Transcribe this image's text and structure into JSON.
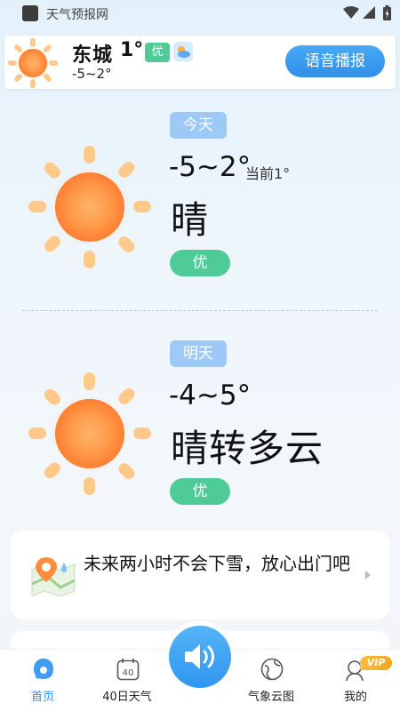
{
  "status_bar": {
    "app_name": "天气预报网"
  },
  "header": {
    "city": "东城",
    "current_temp": "1°",
    "aqi": "优",
    "temp_range": "-5~2°",
    "voice_button": "语音播报"
  },
  "today": {
    "tag": "今天",
    "temp_range": "-5~2°",
    "current": "当前1°",
    "condition": "晴",
    "aqi": "优"
  },
  "tomorrow": {
    "tag": "明天",
    "temp_range": "-4~5°",
    "condition": "晴转多云",
    "aqi": "优"
  },
  "advisory": {
    "text": "未来两小时不会下雪，放心出门吧"
  },
  "nav": {
    "items": [
      {
        "label": "首页",
        "icon": "home-icon",
        "active": true
      },
      {
        "label": "40日天气",
        "icon": "calendar-40-icon",
        "icon_text": "40"
      },
      {
        "label": "气象云图",
        "icon": "globe-icon"
      },
      {
        "label": "我的",
        "icon": "profile-icon",
        "badge": "VIP"
      }
    ]
  },
  "colors": {
    "accent_blue": "#2f8fea",
    "aqi_green": "#4ecb97",
    "day_tag_blue": "#9cc9f6",
    "vip_gold": "#f2a320"
  }
}
